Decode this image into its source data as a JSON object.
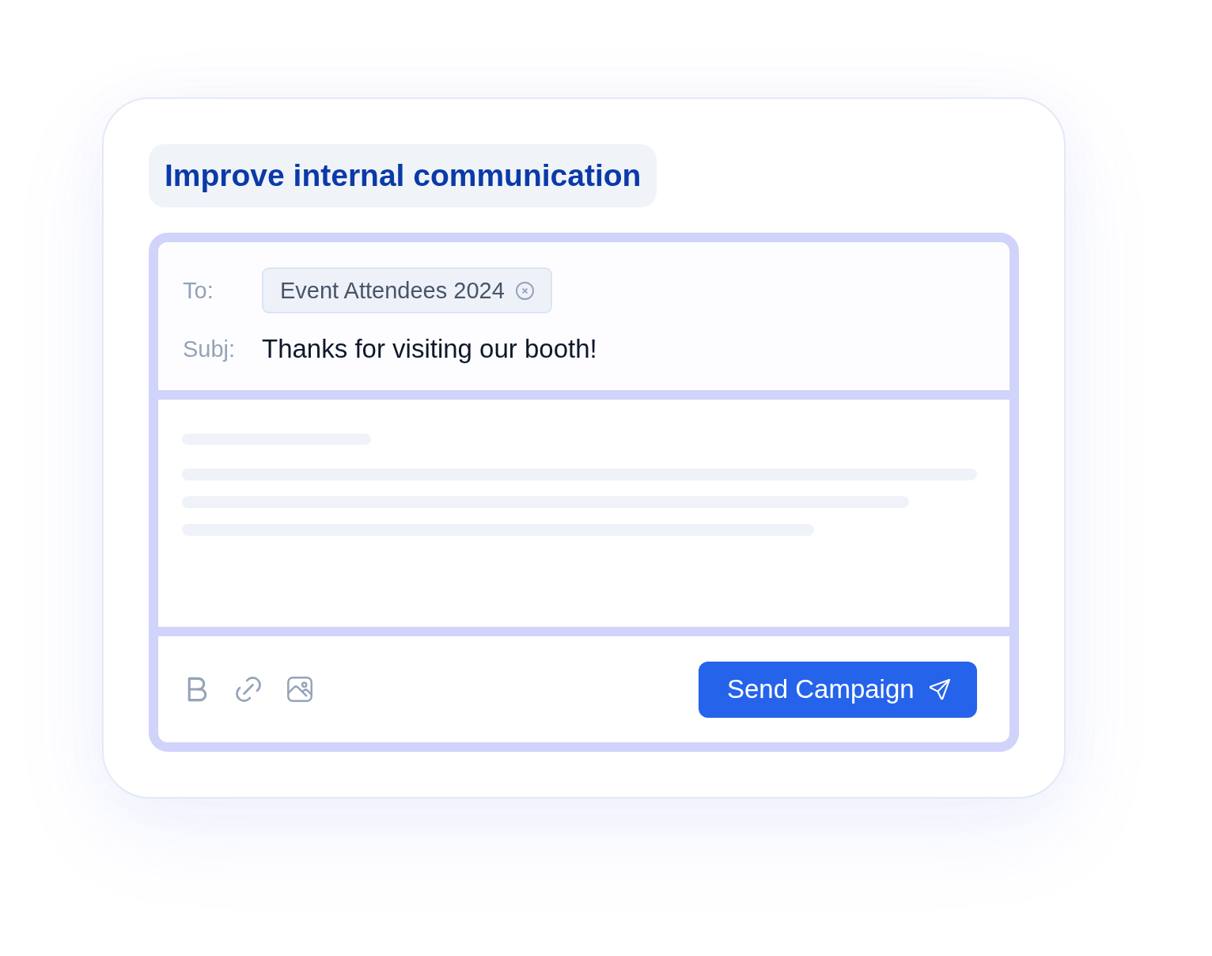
{
  "heading": {
    "text": "Improve internal communication"
  },
  "composer": {
    "to": {
      "label": "To:",
      "recipients": [
        {
          "name": "Event Attendees 2024"
        }
      ]
    },
    "subject": {
      "label": "Subj:",
      "value": "Thanks for visiting our booth!"
    },
    "send_button": {
      "label": "Send Campaign"
    }
  }
}
